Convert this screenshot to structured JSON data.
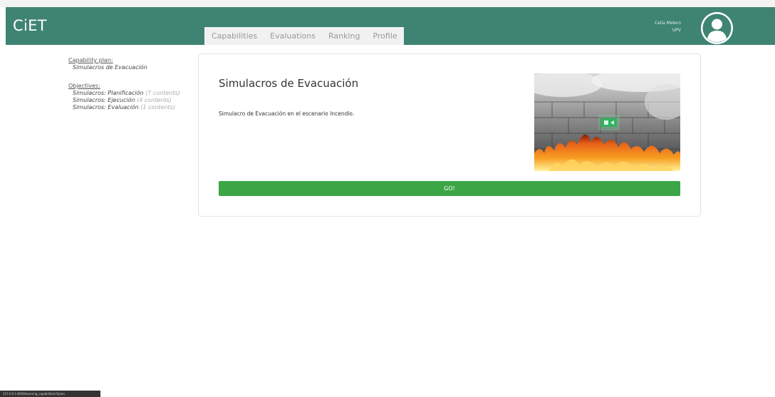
{
  "app": {
    "brand": "CiET"
  },
  "nav": {
    "tabs": [
      {
        "label": "Capabilities"
      },
      {
        "label": "Evaluations"
      },
      {
        "label": "Ranking"
      },
      {
        "label": "Profile"
      }
    ]
  },
  "user": {
    "name": "Celia Melero",
    "org": "UPV",
    "avatar_icon": "user-icon"
  },
  "sidebar": {
    "plan_heading": "Capability plan:",
    "plan_name": "Simulacros de Evacuación",
    "objectives_heading": "Objectives:",
    "objectives": [
      {
        "label": "Simulacros: Planificación",
        "count": "(7 contents)"
      },
      {
        "label": "Simulacros: Ejecución",
        "count": "(4 contents)"
      },
      {
        "label": "Simulacros: Evaluación",
        "count": "(1 contents)"
      }
    ]
  },
  "card": {
    "title": "Simulacros de Evacuación",
    "description": "Simulacro de Evacuación en el escenario Incendio.",
    "image_alt": "Fire and smoke in front of a block wall with an emergency exit sign",
    "button_label": "GO!"
  },
  "status_bar": {
    "url": "127.0.0.1:8000/learning_capabilities/3/plan"
  },
  "colors": {
    "header": "#3f8373",
    "go_button": "#3ca646",
    "fire": "#e8621a"
  }
}
